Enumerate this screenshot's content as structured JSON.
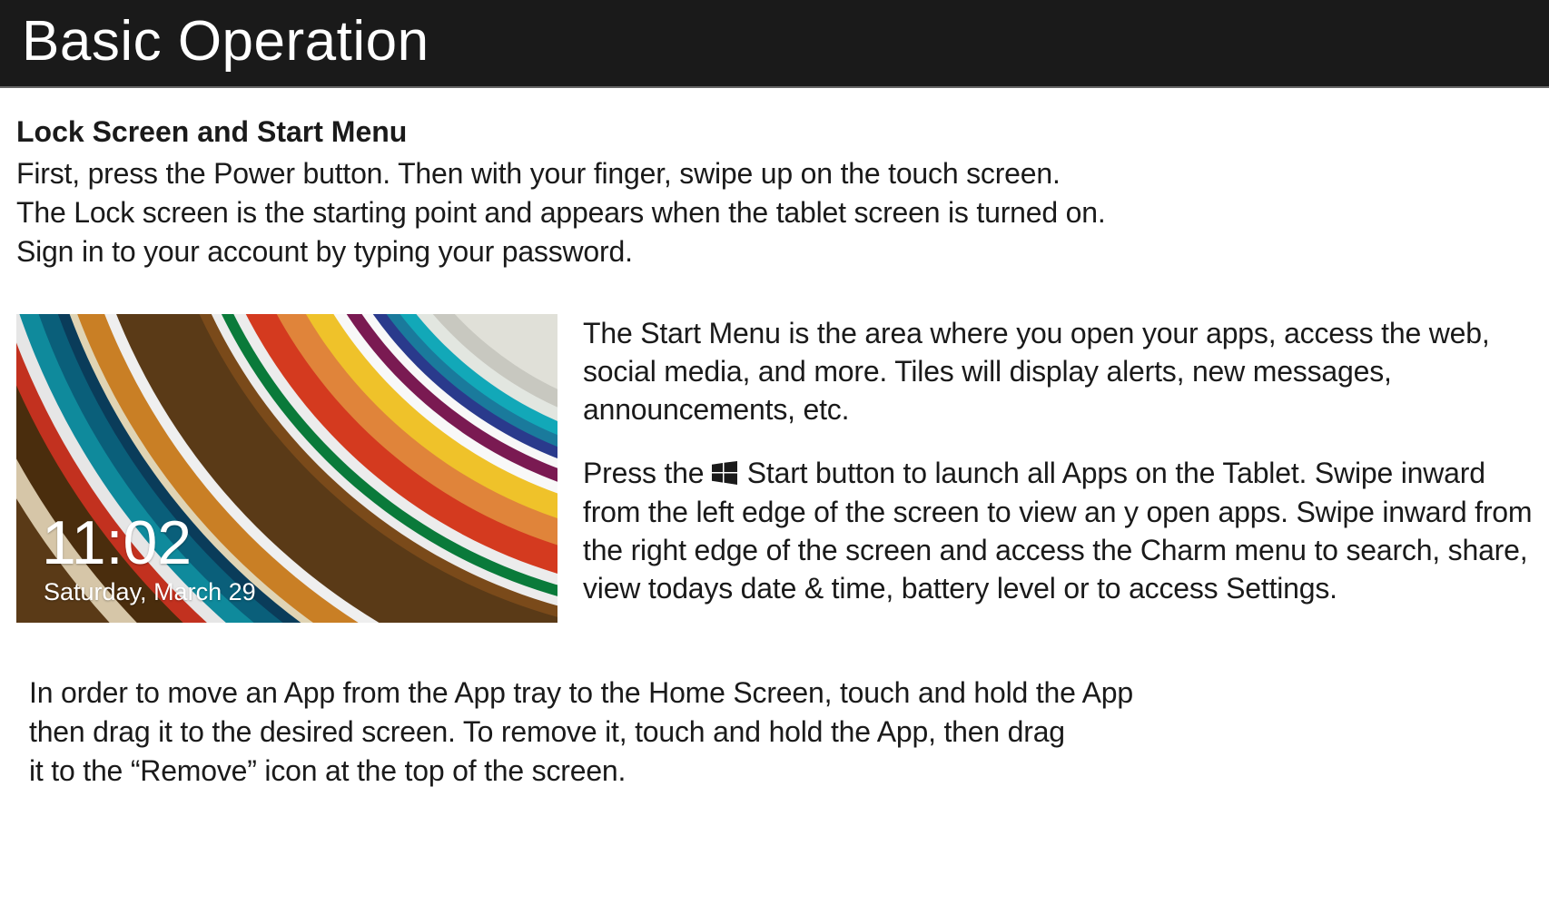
{
  "header": {
    "title": "Basic Operation"
  },
  "section": {
    "subheading": "Lock Screen and Start Menu",
    "intro_line1": "First, press the Power button. Then with your finger, swipe up on the touch screen.",
    "intro_line2": "The Lock screen is the starting point and appears when the tablet screen is turned on.",
    "intro_line3": "Sign in to your account by typing your password."
  },
  "lockscreen": {
    "time": "11:02",
    "date": "Saturday, March 29"
  },
  "side": {
    "para1": "The Start Menu is the area where you open your apps, access the web, social media, and more. Tiles will display alerts, new messages, announcements, etc.",
    "para2_before": "Press the ",
    "para2_after": " Start button to launch all Apps on the Tablet. Swipe inward from the left edge of the screen to view an y open apps. Swipe inward from the right edge of the screen and access the Charm menu to search, share, view todays date & time, battery level or to access Settings."
  },
  "bottom": {
    "line1": "In order to move an App from the App tray to the Home Screen, touch and hold the App",
    "line2": "then drag it to the desired screen. To remove it, touch and hold the App, then drag",
    "line3": " it to the “Remove” icon at the top of the screen."
  }
}
